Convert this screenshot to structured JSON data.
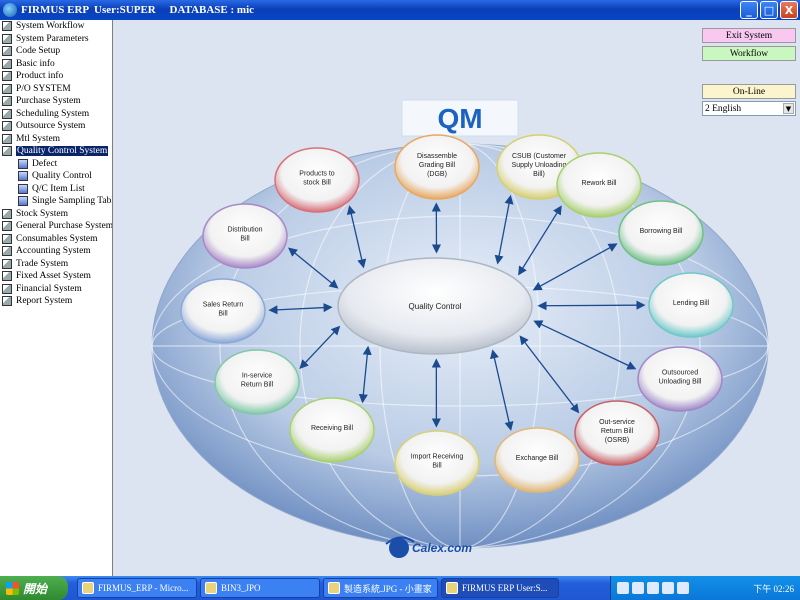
{
  "titlebar": {
    "text": "FIRMUS ERP  User:SUPER     DATABASE : mic"
  },
  "window_controls": {
    "minimize": "_",
    "maximize": "□",
    "close": "X"
  },
  "tree": [
    {
      "label": "System Workflow",
      "sub": false
    },
    {
      "label": "System Parameters",
      "sub": false
    },
    {
      "label": "Code Setup",
      "sub": false
    },
    {
      "label": "Basic info",
      "sub": false
    },
    {
      "label": "Product info",
      "sub": false
    },
    {
      "label": "P/O SYSTEM",
      "sub": false
    },
    {
      "label": "Purchase System",
      "sub": false
    },
    {
      "label": "Scheduling System",
      "sub": false
    },
    {
      "label": "Outsource System",
      "sub": false
    },
    {
      "label": "Mtl System",
      "sub": false
    },
    {
      "label": "Quality Control System",
      "sub": false,
      "selected": true
    },
    {
      "label": "Defect",
      "sub": true
    },
    {
      "label": "Quality Control",
      "sub": true
    },
    {
      "label": "Q/C Item List",
      "sub": true
    },
    {
      "label": "Single Sampling Tabl",
      "sub": true
    },
    {
      "label": "Stock System",
      "sub": false
    },
    {
      "label": "General Purchase System",
      "sub": false
    },
    {
      "label": "Consumables System",
      "sub": false
    },
    {
      "label": "Accounting System",
      "sub": false
    },
    {
      "label": "Trade System",
      "sub": false
    },
    {
      "label": "Fixed Asset System",
      "sub": false
    },
    {
      "label": "Financial System",
      "sub": false
    },
    {
      "label": "Report System",
      "sub": false
    }
  ],
  "controls": {
    "exit_label": "Exit System",
    "workflow_label": "Workflow",
    "status": "On-Line",
    "language": "2 English",
    "exit_color": "#f8c8f0",
    "workflow_color": "#c8f7c0"
  },
  "diagram": {
    "title": "QM",
    "center": "Quality Control",
    "nodes": [
      {
        "label": "Products to stock Bill",
        "color": "#d8707a"
      },
      {
        "label": "Disassemble Grading Bill (DGB)",
        "color": "#e8a860"
      },
      {
        "label": "CSUB (Customer Supply Unloading Bill)",
        "color": "#d6cf70"
      },
      {
        "label": "Rework Bill",
        "color": "#a8d070"
      },
      {
        "label": "Borrowing Bill",
        "color": "#70c088"
      },
      {
        "label": "Lending Bill",
        "color": "#70c8c8"
      },
      {
        "label": "Outsourced Unloading Bill",
        "color": "#a088c8"
      },
      {
        "label": "Out-service Return Bill (OSRB)",
        "color": "#c86068"
      },
      {
        "label": "Exchange Bill",
        "color": "#e0b878"
      },
      {
        "label": "Import Receiving Bill",
        "color": "#d8d078"
      },
      {
        "label": "Receiving Bill",
        "color": "#a8d070"
      },
      {
        "label": "In-service Return Bill",
        "color": "#80c8a8"
      },
      {
        "label": "Sales Return Bill",
        "color": "#8aa8d8"
      },
      {
        "label": "Distribution Bill",
        "color": "#a888c8"
      }
    ]
  },
  "logo_text": "Calex.com",
  "taskbar": {
    "start": "開始",
    "items": [
      {
        "label": "FIRMUS_ERP - Micro...",
        "active": false
      },
      {
        "label": "BIN3_JPO",
        "active": false
      },
      {
        "label": "製造系統.JPG - 小畫家",
        "active": false
      },
      {
        "label": "FIRMUS ERP  User:S...",
        "active": true
      }
    ],
    "clock": "下午 02:26"
  }
}
